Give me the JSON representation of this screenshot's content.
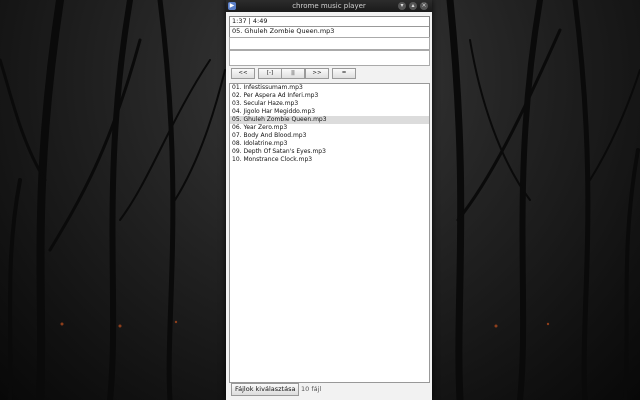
{
  "window": {
    "title": "chrome music player"
  },
  "player": {
    "time": "1:37 | 4:49",
    "current_track": "05. Ghuleh Zombie Queen.mp3"
  },
  "controls": {
    "prev": "<<",
    "stop": "[-]",
    "pause": "||",
    "next": ">>",
    "eq": "="
  },
  "playlist": {
    "selected_index": 4,
    "items": [
      "01. Infestissumam.mp3",
      "02. Per Aspera Ad Inferi.mp3",
      "03. Secular Haze.mp3",
      "04. Jigolo Har Megiddo.mp3",
      "05. Ghuleh Zombie Queen.mp3",
      "06. Year Zero.mp3",
      "07. Body And Blood.mp3",
      "08. Idolatrine.mp3",
      "09. Depth Of Satan's Eyes.mp3",
      "10. Monstrance Clock.mp3"
    ]
  },
  "footer": {
    "file_button": "Fájlok kiválasztása",
    "file_count": "10 fájl"
  }
}
